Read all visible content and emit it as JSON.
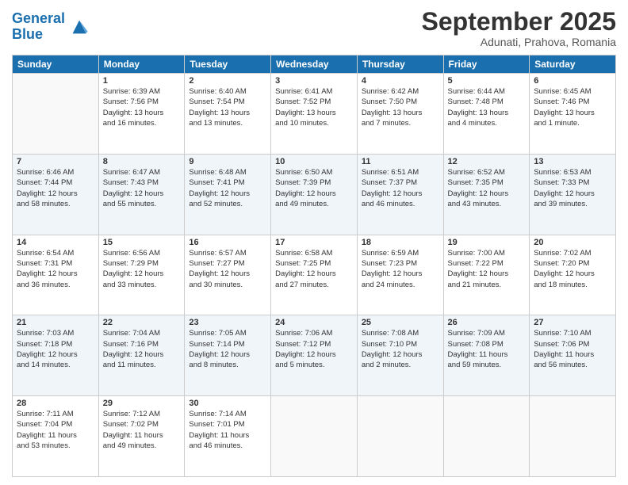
{
  "header": {
    "logo_line1": "General",
    "logo_line2": "Blue",
    "month": "September 2025",
    "location": "Adunati, Prahova, Romania"
  },
  "weekdays": [
    "Sunday",
    "Monday",
    "Tuesday",
    "Wednesday",
    "Thursday",
    "Friday",
    "Saturday"
  ],
  "weeks": [
    [
      {
        "day": "",
        "info": ""
      },
      {
        "day": "1",
        "info": "Sunrise: 6:39 AM\nSunset: 7:56 PM\nDaylight: 13 hours\nand 16 minutes."
      },
      {
        "day": "2",
        "info": "Sunrise: 6:40 AM\nSunset: 7:54 PM\nDaylight: 13 hours\nand 13 minutes."
      },
      {
        "day": "3",
        "info": "Sunrise: 6:41 AM\nSunset: 7:52 PM\nDaylight: 13 hours\nand 10 minutes."
      },
      {
        "day": "4",
        "info": "Sunrise: 6:42 AM\nSunset: 7:50 PM\nDaylight: 13 hours\nand 7 minutes."
      },
      {
        "day": "5",
        "info": "Sunrise: 6:44 AM\nSunset: 7:48 PM\nDaylight: 13 hours\nand 4 minutes."
      },
      {
        "day": "6",
        "info": "Sunrise: 6:45 AM\nSunset: 7:46 PM\nDaylight: 13 hours\nand 1 minute."
      }
    ],
    [
      {
        "day": "7",
        "info": "Sunrise: 6:46 AM\nSunset: 7:44 PM\nDaylight: 12 hours\nand 58 minutes."
      },
      {
        "day": "8",
        "info": "Sunrise: 6:47 AM\nSunset: 7:43 PM\nDaylight: 12 hours\nand 55 minutes."
      },
      {
        "day": "9",
        "info": "Sunrise: 6:48 AM\nSunset: 7:41 PM\nDaylight: 12 hours\nand 52 minutes."
      },
      {
        "day": "10",
        "info": "Sunrise: 6:50 AM\nSunset: 7:39 PM\nDaylight: 12 hours\nand 49 minutes."
      },
      {
        "day": "11",
        "info": "Sunrise: 6:51 AM\nSunset: 7:37 PM\nDaylight: 12 hours\nand 46 minutes."
      },
      {
        "day": "12",
        "info": "Sunrise: 6:52 AM\nSunset: 7:35 PM\nDaylight: 12 hours\nand 43 minutes."
      },
      {
        "day": "13",
        "info": "Sunrise: 6:53 AM\nSunset: 7:33 PM\nDaylight: 12 hours\nand 39 minutes."
      }
    ],
    [
      {
        "day": "14",
        "info": "Sunrise: 6:54 AM\nSunset: 7:31 PM\nDaylight: 12 hours\nand 36 minutes."
      },
      {
        "day": "15",
        "info": "Sunrise: 6:56 AM\nSunset: 7:29 PM\nDaylight: 12 hours\nand 33 minutes."
      },
      {
        "day": "16",
        "info": "Sunrise: 6:57 AM\nSunset: 7:27 PM\nDaylight: 12 hours\nand 30 minutes."
      },
      {
        "day": "17",
        "info": "Sunrise: 6:58 AM\nSunset: 7:25 PM\nDaylight: 12 hours\nand 27 minutes."
      },
      {
        "day": "18",
        "info": "Sunrise: 6:59 AM\nSunset: 7:23 PM\nDaylight: 12 hours\nand 24 minutes."
      },
      {
        "day": "19",
        "info": "Sunrise: 7:00 AM\nSunset: 7:22 PM\nDaylight: 12 hours\nand 21 minutes."
      },
      {
        "day": "20",
        "info": "Sunrise: 7:02 AM\nSunset: 7:20 PM\nDaylight: 12 hours\nand 18 minutes."
      }
    ],
    [
      {
        "day": "21",
        "info": "Sunrise: 7:03 AM\nSunset: 7:18 PM\nDaylight: 12 hours\nand 14 minutes."
      },
      {
        "day": "22",
        "info": "Sunrise: 7:04 AM\nSunset: 7:16 PM\nDaylight: 12 hours\nand 11 minutes."
      },
      {
        "day": "23",
        "info": "Sunrise: 7:05 AM\nSunset: 7:14 PM\nDaylight: 12 hours\nand 8 minutes."
      },
      {
        "day": "24",
        "info": "Sunrise: 7:06 AM\nSunset: 7:12 PM\nDaylight: 12 hours\nand 5 minutes."
      },
      {
        "day": "25",
        "info": "Sunrise: 7:08 AM\nSunset: 7:10 PM\nDaylight: 12 hours\nand 2 minutes."
      },
      {
        "day": "26",
        "info": "Sunrise: 7:09 AM\nSunset: 7:08 PM\nDaylight: 11 hours\nand 59 minutes."
      },
      {
        "day": "27",
        "info": "Sunrise: 7:10 AM\nSunset: 7:06 PM\nDaylight: 11 hours\nand 56 minutes."
      }
    ],
    [
      {
        "day": "28",
        "info": "Sunrise: 7:11 AM\nSunset: 7:04 PM\nDaylight: 11 hours\nand 53 minutes."
      },
      {
        "day": "29",
        "info": "Sunrise: 7:12 AM\nSunset: 7:02 PM\nDaylight: 11 hours\nand 49 minutes."
      },
      {
        "day": "30",
        "info": "Sunrise: 7:14 AM\nSunset: 7:01 PM\nDaylight: 11 hours\nand 46 minutes."
      },
      {
        "day": "",
        "info": ""
      },
      {
        "day": "",
        "info": ""
      },
      {
        "day": "",
        "info": ""
      },
      {
        "day": "",
        "info": ""
      }
    ]
  ]
}
